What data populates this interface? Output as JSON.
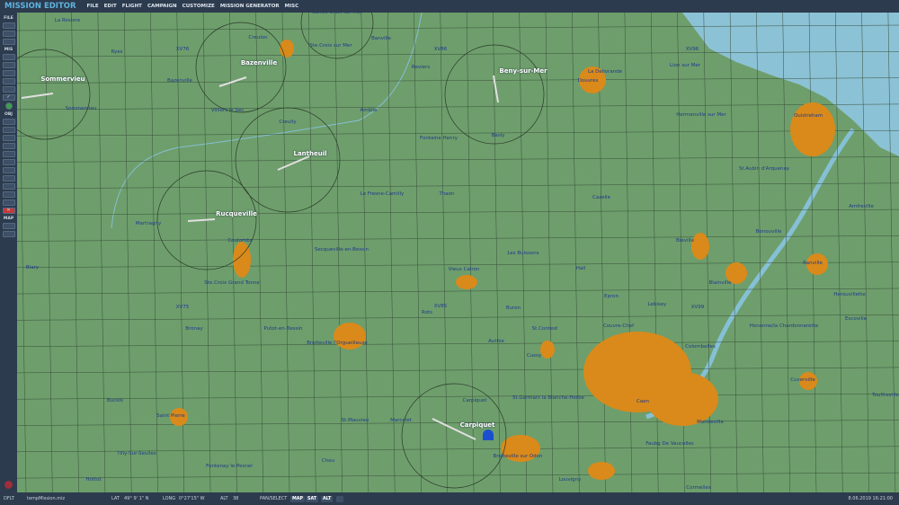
{
  "app": {
    "title": "MISSION EDITOR",
    "menu": [
      "FILE",
      "EDIT",
      "FLIGHT",
      "CAMPAIGN",
      "CUSTOMIZE",
      "MISSION GENERATOR",
      "MISC"
    ]
  },
  "toolbar": {
    "sections": [
      "FILE",
      "MIS",
      "OBJ",
      "MAP"
    ]
  },
  "map": {
    "colors": {
      "land": "#6e9e6c",
      "town": "#d98a1a",
      "sea": "#8cc2d6",
      "river": "#86c0d6",
      "grid": "#38503a"
    },
    "airfields": [
      "Bazenville",
      "Sommervieu",
      "Beny-sur-Mer",
      "Lantheuil",
      "Rucqueville",
      "Carpiquet"
    ],
    "labels": [
      "La Rosiere",
      "Sainte Croix sur Mer",
      "Creulon",
      "Banville",
      "XV76",
      "XV86",
      "XV96",
      "Ryes",
      "Ste.Croix sur Mer",
      "Reviers",
      "La Delivrande",
      "Lion sur Mer",
      "Bazenville",
      "Douvres",
      "Sommervieu",
      "Villiers le Sec",
      "Amblie",
      "Hermanville sur Mer",
      "Ouistreham",
      "Creully",
      "Fontaine Henry",
      "Basly",
      "St.Aubin d'Arquenay",
      "Le Fresne-Camilly",
      "Thaon",
      "Cazelle",
      "Martragny",
      "Amfreville",
      "Benouville",
      "Bieville",
      "Coulombs",
      "Secqueville-en-Bessin",
      "Les Buissons",
      "Vieux Cairon",
      "Hall",
      "Ranville",
      "Blary",
      "Blainville",
      "Ste.Croix Grand Tonne",
      "Herouvillette",
      "Epron",
      "Lebisey",
      "XV99",
      "XV85",
      "XV75",
      "Rots",
      "Buron",
      "Escoville",
      "Bronay",
      "Putot-en-Bessin",
      "St.Contest",
      "Couvre-Chef",
      "Hononne/la Chardonnerette",
      "Bretteville l'Orgueilleuse",
      "Authie",
      "Colombelles",
      "Cussy",
      "Cuverville",
      "Bucels",
      "St.Germain la Blanche-Herbe",
      "Carpiquet",
      "Caen",
      "Touffreville",
      "Saint Pierre",
      "St.Mauvieu",
      "Marcelet",
      "Mondeville",
      "Faubg De Vaucelles",
      "Tilly-Sur-Seulles",
      "Bretteville sur Odon",
      "Cheu",
      "Fontenay le Pesnel",
      "Hottot",
      "Louvigny",
      "Cormelles"
    ]
  },
  "status": {
    "profile": "DFLT",
    "file": "tempMission.miz",
    "lat_label": "LAT",
    "lat": "49° 9' 1\" N",
    "long_label": "LONG",
    "long": "0°27'15\" W",
    "alt_label": "ALT",
    "alt": "38",
    "mode": "PAN/SELECT",
    "map_btn": "MAP",
    "sat_btn": "SAT",
    "alt_btn": "ALT",
    "date": "8.06.2019 16:21:00"
  }
}
